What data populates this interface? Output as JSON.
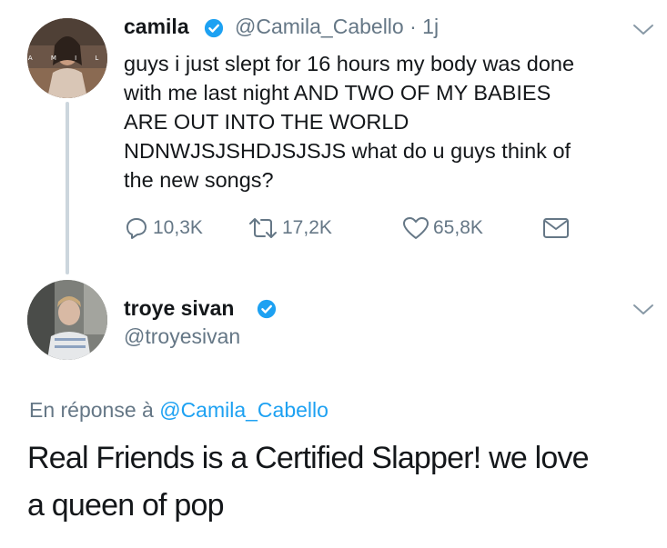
{
  "tweet": {
    "author_name": "camila",
    "author_handle": "@Camila_Cabello",
    "time": "· 1j",
    "avatar_text": "C A M I L A",
    "text_lines": [
      "guys i just slept for 16 hours my body was done",
      "with me last night AND TWO OF MY BABIES",
      "ARE OUT INTO THE WORLD",
      "NDNWJSJSHDJSJSJS what do u guys think of",
      "the new songs?"
    ],
    "replies": "10,3K",
    "retweets": "17,2K",
    "likes": "65,8K"
  },
  "reply": {
    "author_name": "troye sivan",
    "author_handle": "@troyesivan",
    "reply_to_label": "En réponse à",
    "reply_to_handle": "@Camila_Cabello",
    "text_lines": [
      "Real Friends is a Certified Slapper! we love",
      "a queen of pop"
    ]
  },
  "colors": {
    "text": "#14171a",
    "secondary": "#657786",
    "link": "#1da1f2",
    "verified": "#1da1f2",
    "thread_line": "#ccd6dd"
  },
  "icons": [
    "verified-badge-icon",
    "chevron-down-icon",
    "reply-icon",
    "retweet-icon",
    "like-icon",
    "direct-message-icon"
  ]
}
